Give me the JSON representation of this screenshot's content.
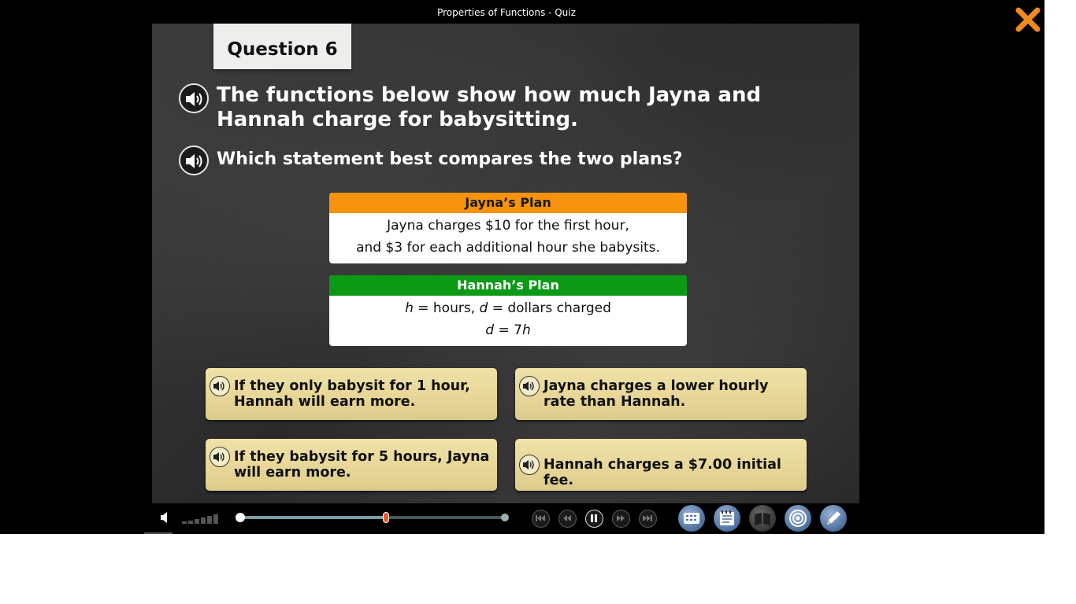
{
  "window": {
    "title": "Properties of Functions - Quiz"
  },
  "question": {
    "number_label": "Question 6",
    "prompt": "The functions below show how much Jayna and Hannah charge for babysitting.",
    "sub_prompt": "Which statement best compares the two plans?"
  },
  "plans": {
    "jayna": {
      "title": "Jayna’s Plan",
      "line1": "Jayna charges $10 for the first hour,",
      "line2": "and $3 for each additional hour she babysits."
    },
    "hannah": {
      "title": "Hannah’s Plan",
      "var_h": "h",
      "line1_rest_a": " = hours, ",
      "var_d": "d",
      "line1_rest_b": " = dollars charged",
      "eq_d": "d",
      "eq_mid": " = 7",
      "eq_h": "h"
    }
  },
  "answers": [
    {
      "id": "a",
      "text": "If they only babysit for 1 hour, Hannah will earn more."
    },
    {
      "id": "b",
      "text": "Jayna charges a lower hourly rate than Hannah."
    },
    {
      "id": "c",
      "text": "If they babysit for 5 hours, Jayna will earn more."
    },
    {
      "id": "d",
      "text": "Hannah charges a $7.00 initial fee."
    }
  ],
  "player": {
    "progress_fraction": 0.55
  },
  "colors": {
    "jayna_header": "#f7930c",
    "hannah_header": "#0c9a16",
    "close_icon": "#f08a1c",
    "progress_marker": "#ee5a2a"
  },
  "icons": {
    "close": "close-x-icon",
    "audio": "speaker-audio-icon",
    "tools": [
      "calculator-icon",
      "notepad-icon",
      "book-icon",
      "target-icon",
      "pencil-icon"
    ]
  }
}
